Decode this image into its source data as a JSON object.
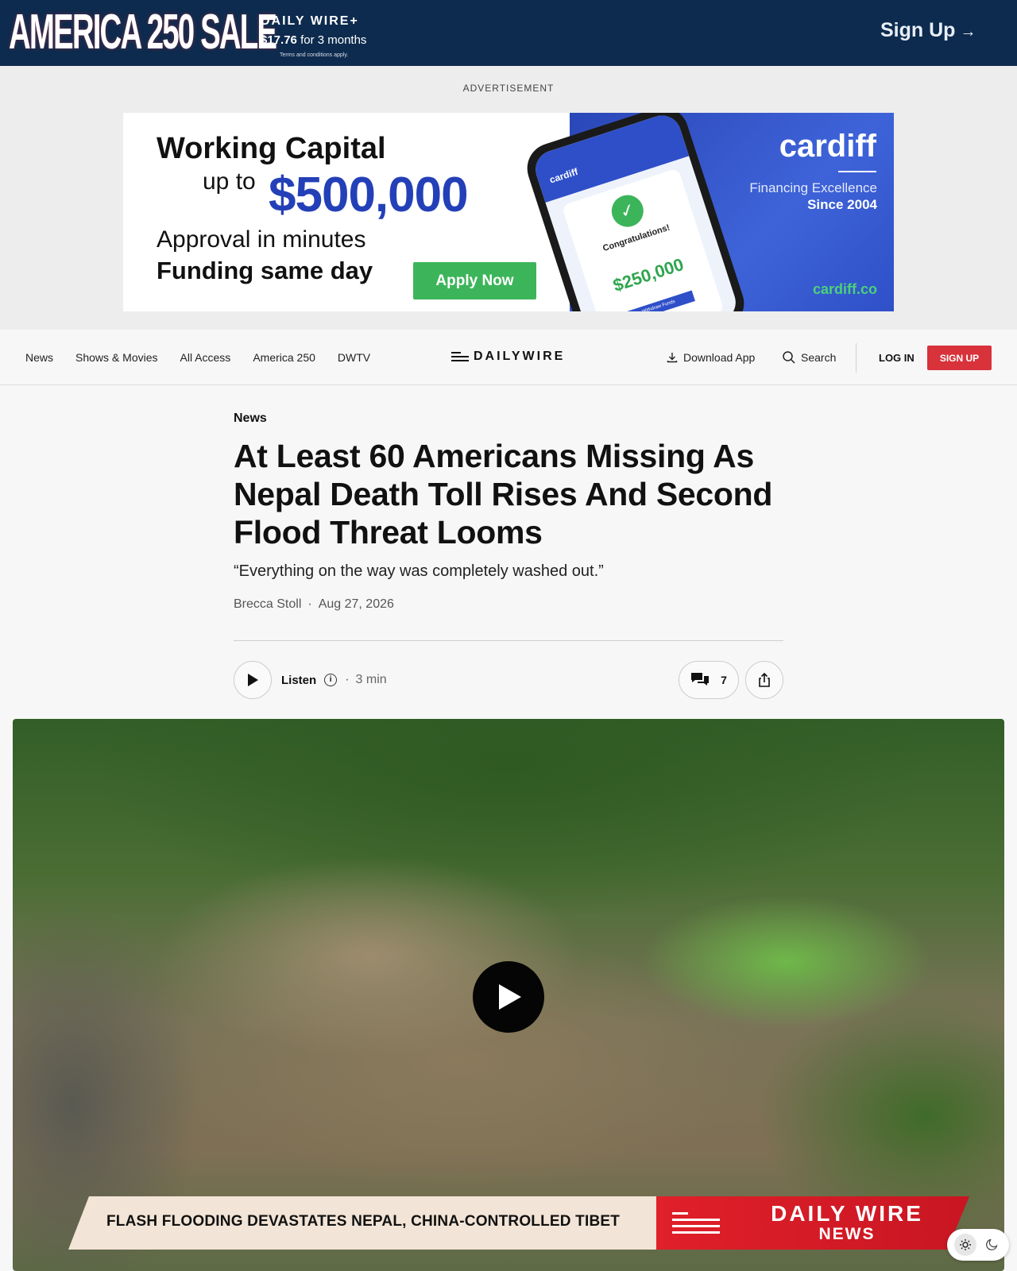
{
  "promo": {
    "title": "AMERICA 250 SALE",
    "brand": "DAILY WIRE+",
    "price": "$17.76",
    "price_suffix": "for 3 months",
    "terms": "Terms and conditions apply.",
    "signup": "Sign Up"
  },
  "ad": {
    "label": "ADVERTISEMENT",
    "headline": "Working Capital",
    "upto": "up to",
    "amount": "$500,000",
    "approval": "Approval in minutes",
    "funding": "Funding same day",
    "cta": "Apply Now",
    "phone_brand": "cardiff",
    "phone_congrats": "Congratulations!",
    "phone_amount": "$250,000",
    "phone_button": "Withdraw Funds",
    "brand": "cardiff",
    "tagline": "Financing Excellence",
    "since": "Since 2004",
    "url": "cardiff.co"
  },
  "nav": {
    "links": [
      "News",
      "Shows & Movies",
      "All Access",
      "America 250",
      "DWTV"
    ],
    "logo": "DAILYWIRE",
    "download": "Download App",
    "search": "Search",
    "login": "LOG IN",
    "signup": "SIGN UP"
  },
  "article": {
    "kicker": "News",
    "headline": "At Least 60 Americans Missing As Nepal Death Toll Rises And Second Flood Threat Looms",
    "dek": "“Everything on the way was completely washed out.”",
    "author": "Brecca Stoll",
    "date": "Aug 27, 2026",
    "listen_label": "Listen",
    "read_time": "3 min",
    "comment_count": "7"
  },
  "video": {
    "lower_third": "FLASH FLOODING DEVASTATES NEPAL, CHINA-CONTROLLED TIBET",
    "brand_line1": "DAILY WIRE",
    "brand_line2": "NEWS"
  },
  "colors": {
    "promo_bg": "#0d2b4e",
    "signup_red": "#d8323a",
    "ad_blue": "#2a47b8",
    "apply_green": "#3cb55a"
  }
}
